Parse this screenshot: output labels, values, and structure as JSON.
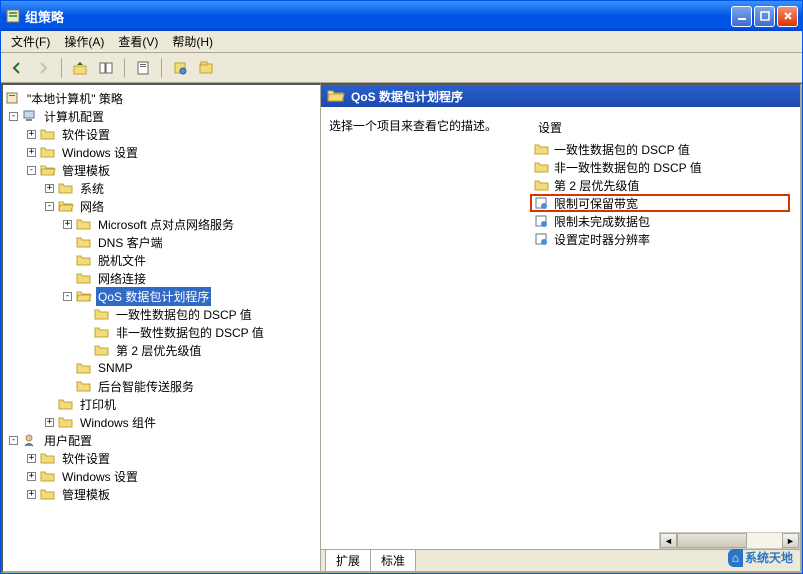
{
  "window": {
    "title": "组策略"
  },
  "menu": {
    "file": "文件(F)",
    "action": "操作(A)",
    "view": "查看(V)",
    "help": "帮助(H)"
  },
  "tree": {
    "root": "\"本地计算机\" 策略",
    "computer_config": "计算机配置",
    "software_settings": "软件设置",
    "windows_settings": "Windows 设置",
    "admin_templates": "管理模板",
    "system": "系统",
    "network": "网络",
    "ms_p2p": "Microsoft 点对点网络服务",
    "dns_client": "DNS 客户端",
    "offline_files": "脱机文件",
    "net_connections": "网络连接",
    "qos": "QoS 数据包计划程序",
    "qos_dscp_conforming": "一致性数据包的 DSCP 值",
    "qos_dscp_nonconforming": "非一致性数据包的 DSCP 值",
    "qos_layer2": "第 2 层优先级值",
    "snmp": "SNMP",
    "bits": "后台智能传送服务",
    "printers": "打印机",
    "windows_components": "Windows 组件",
    "user_config": "用户配置",
    "u_software": "软件设置",
    "u_windows": "Windows 设置",
    "u_admin": "管理模板"
  },
  "right": {
    "header": "QoS 数据包计划程序",
    "description": "选择一个项目来查看它的描述。",
    "settings_header": "设置",
    "items": [
      {
        "label": "一致性数据包的 DSCP 值",
        "type": "folder"
      },
      {
        "label": "非一致性数据包的 DSCP 值",
        "type": "folder"
      },
      {
        "label": "第 2 层优先级值",
        "type": "folder"
      },
      {
        "label": "限制可保留带宽",
        "type": "setting",
        "highlighted": true
      },
      {
        "label": "限制未完成数据包",
        "type": "setting"
      },
      {
        "label": "设置定时器分辨率",
        "type": "setting"
      }
    ]
  },
  "tabs": {
    "extended": "扩展",
    "standard": "标准"
  },
  "watermark": "系统天地"
}
